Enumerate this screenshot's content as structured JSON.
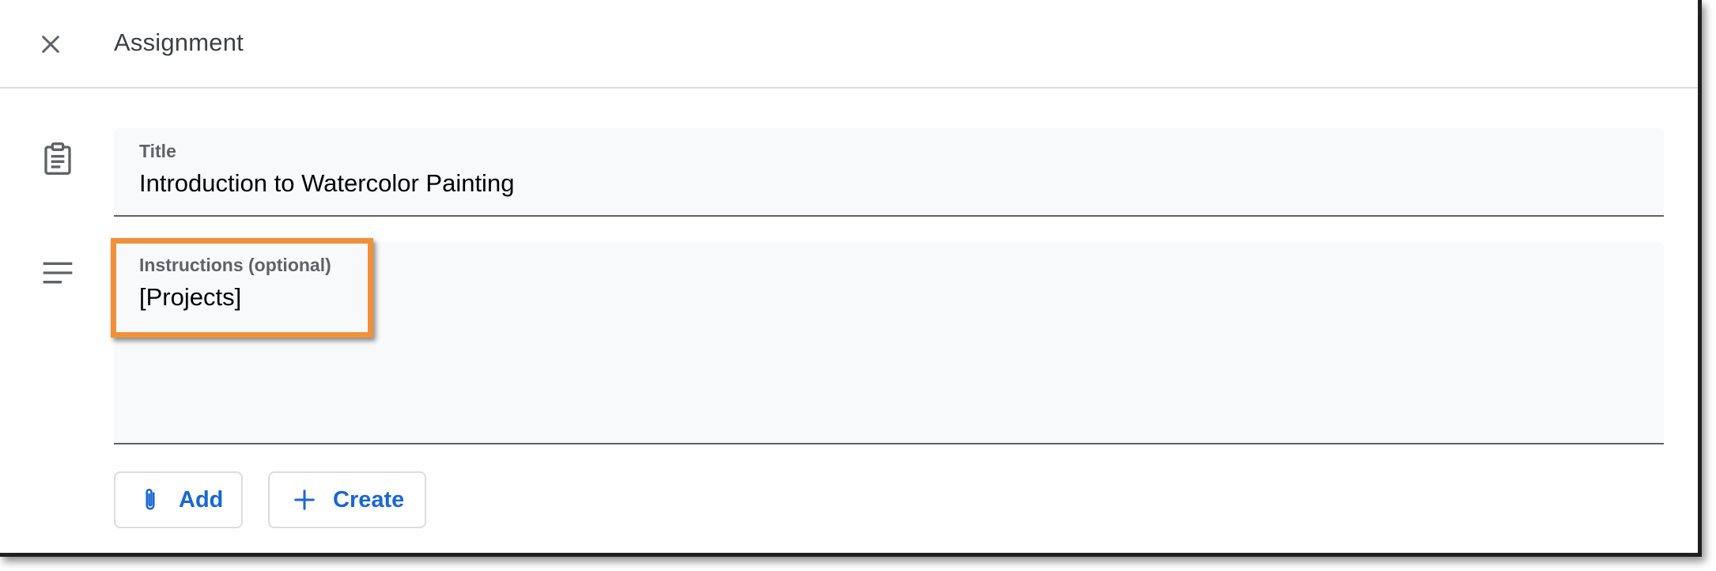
{
  "header": {
    "title": "Assignment",
    "close_icon": "close-icon"
  },
  "form": {
    "title_field": {
      "icon": "assignment-clipboard-icon",
      "label": "Title",
      "value": "Introduction to Watercolor Painting"
    },
    "instructions_field": {
      "icon": "notes-lines-icon",
      "label": "Instructions (optional)",
      "value": "[Projects]",
      "highlighted": true
    }
  },
  "actions": {
    "add": {
      "label": "Add",
      "icon": "paperclip-icon"
    },
    "create": {
      "label": "Create",
      "icon": "plus-icon"
    }
  },
  "colors": {
    "accent": "#1967d2",
    "highlight": "#f0913a",
    "field_bg": "#f8f9fa",
    "icon": "#5f6368"
  }
}
